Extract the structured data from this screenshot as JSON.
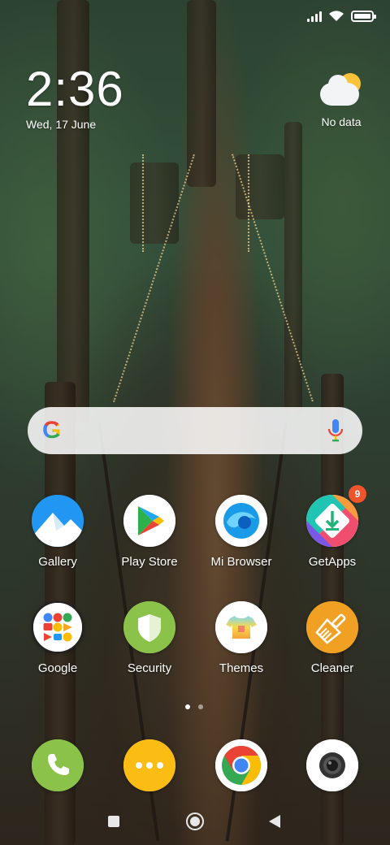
{
  "status_bar": {
    "signal_icon": "cellular-signal-icon",
    "wifi_icon": "wifi-icon",
    "battery_icon": "battery-icon",
    "battery_level": 1.0
  },
  "clock": {
    "time": "2:36",
    "date": "Wed, 17 June"
  },
  "weather": {
    "icon": "partly-cloudy-icon",
    "text": "No data"
  },
  "search": {
    "logo": "G",
    "mic_icon": "microphone-icon"
  },
  "apps": [
    {
      "label": "Gallery",
      "icon": "gallery-icon"
    },
    {
      "label": "Play Store",
      "icon": "play-store-icon"
    },
    {
      "label": "Mi Browser",
      "icon": "mi-browser-icon"
    },
    {
      "label": "GetApps",
      "icon": "getapps-icon",
      "badge": "9"
    },
    {
      "label": "Google",
      "icon": "google-folder-icon"
    },
    {
      "label": "Security",
      "icon": "security-shield-icon"
    },
    {
      "label": "Themes",
      "icon": "themes-tshirt-icon"
    },
    {
      "label": "Cleaner",
      "icon": "cleaner-brush-icon"
    }
  ],
  "dock": [
    {
      "icon": "phone-icon"
    },
    {
      "icon": "messaging-icon"
    },
    {
      "icon": "chrome-icon"
    },
    {
      "icon": "camera-icon"
    }
  ],
  "pages": {
    "count": 2,
    "active": 1
  },
  "nav": {
    "recents": "recents-square-icon",
    "home": "home-circle-icon",
    "back": "back-triangle-icon"
  },
  "colors": {
    "badge": "#f0542d",
    "phone": "#8bc34a",
    "messaging": "#fbbd14",
    "security": "#8bc34a",
    "cleaner": "#f0a023"
  }
}
